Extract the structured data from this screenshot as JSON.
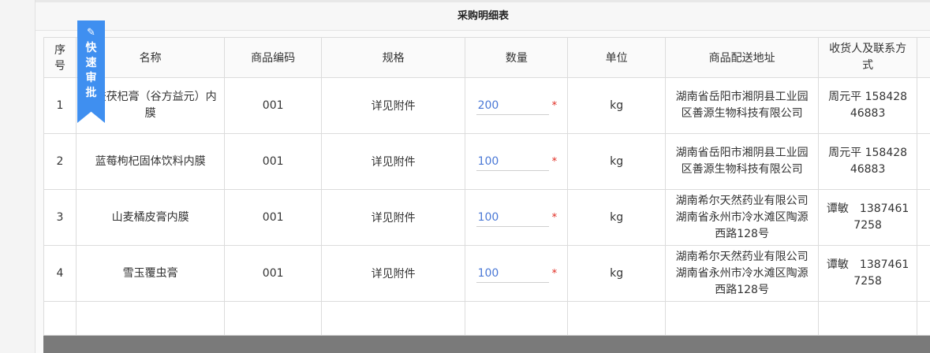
{
  "page_title": "采购明细表",
  "badge": {
    "label": "快速审批",
    "icon": "pencil-icon"
  },
  "table": {
    "headers": [
      "序号",
      "名称",
      "商品编码",
      "规格",
      "数量",
      "单位",
      "商品配送地址",
      "收货人及联系方式"
    ],
    "rows": [
      {
        "index": "1",
        "name": "阿胶茯杞膏（谷方益元）内膜",
        "code": "001",
        "spec": "详见附件",
        "qty": "200",
        "unit": "kg",
        "address": "湖南省岳阳市湘阴县工业园区善源生物科技有限公司",
        "contact": "周元平 15842846883"
      },
      {
        "index": "2",
        "name": "蓝莓枸杞固体饮料内膜",
        "code": "001",
        "spec": "详见附件",
        "qty": "100",
        "unit": "kg",
        "address": "湖南省岳阳市湘阴县工业园区善源生物科技有限公司",
        "contact": "周元平 15842846883"
      },
      {
        "index": "3",
        "name": "山麦橘皮膏内膜",
        "code": "001",
        "spec": "详见附件",
        "qty": "100",
        "unit": "kg",
        "address": "湖南希尔天然药业有限公司　湖南省永州市冷水滩区陶源西路128号",
        "contact": "谭敏　13874617258"
      },
      {
        "index": "4",
        "name": "雪玉覆虫膏",
        "code": "001",
        "spec": "详见附件",
        "qty": "100",
        "unit": "kg",
        "address": "湖南希尔天然药业有限公司　湖南省永州市冷水滩区陶源西路128号",
        "contact": "谭敏　13874617258"
      }
    ],
    "required_mark": "*"
  },
  "colors": {
    "accent": "#3f8ff0",
    "required": "#e0281e",
    "qty_text": "#4a78d6"
  }
}
